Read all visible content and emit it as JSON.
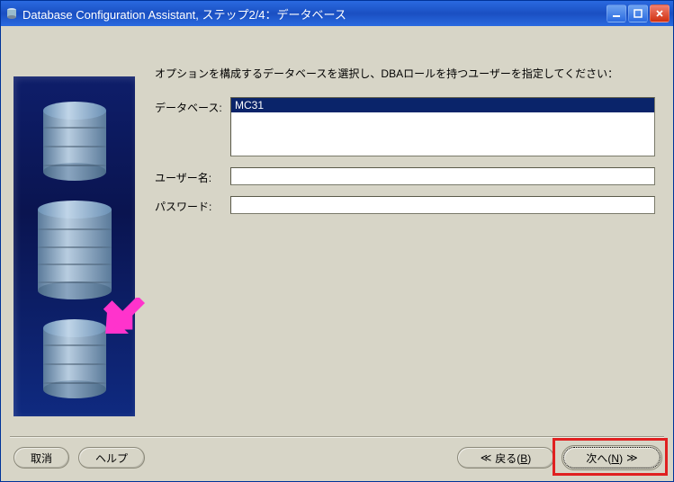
{
  "window": {
    "title": "Database Configuration Assistant, ステップ2/4：データベース"
  },
  "instruction": "オプションを構成するデータベースを選択し、DBAロールを持つユーザーを指定してください：",
  "labels": {
    "database": "データベース:",
    "username": "ユーザー名:",
    "password": "パスワード:"
  },
  "database_list": {
    "items": [
      "MC31"
    ],
    "selected_index": 0
  },
  "fields": {
    "username": "",
    "password": ""
  },
  "buttons": {
    "cancel": "取消",
    "help": "ヘルプ",
    "back": "戻る",
    "back_mnemonic": "B",
    "next": "次へ",
    "next_mnemonic": "N"
  },
  "colors": {
    "titlebar": "#2a6ae0",
    "client_bg": "#d7d5c7",
    "selection": "#0a246a",
    "highlight": "#e02020",
    "arrow": "#ff33cc"
  }
}
